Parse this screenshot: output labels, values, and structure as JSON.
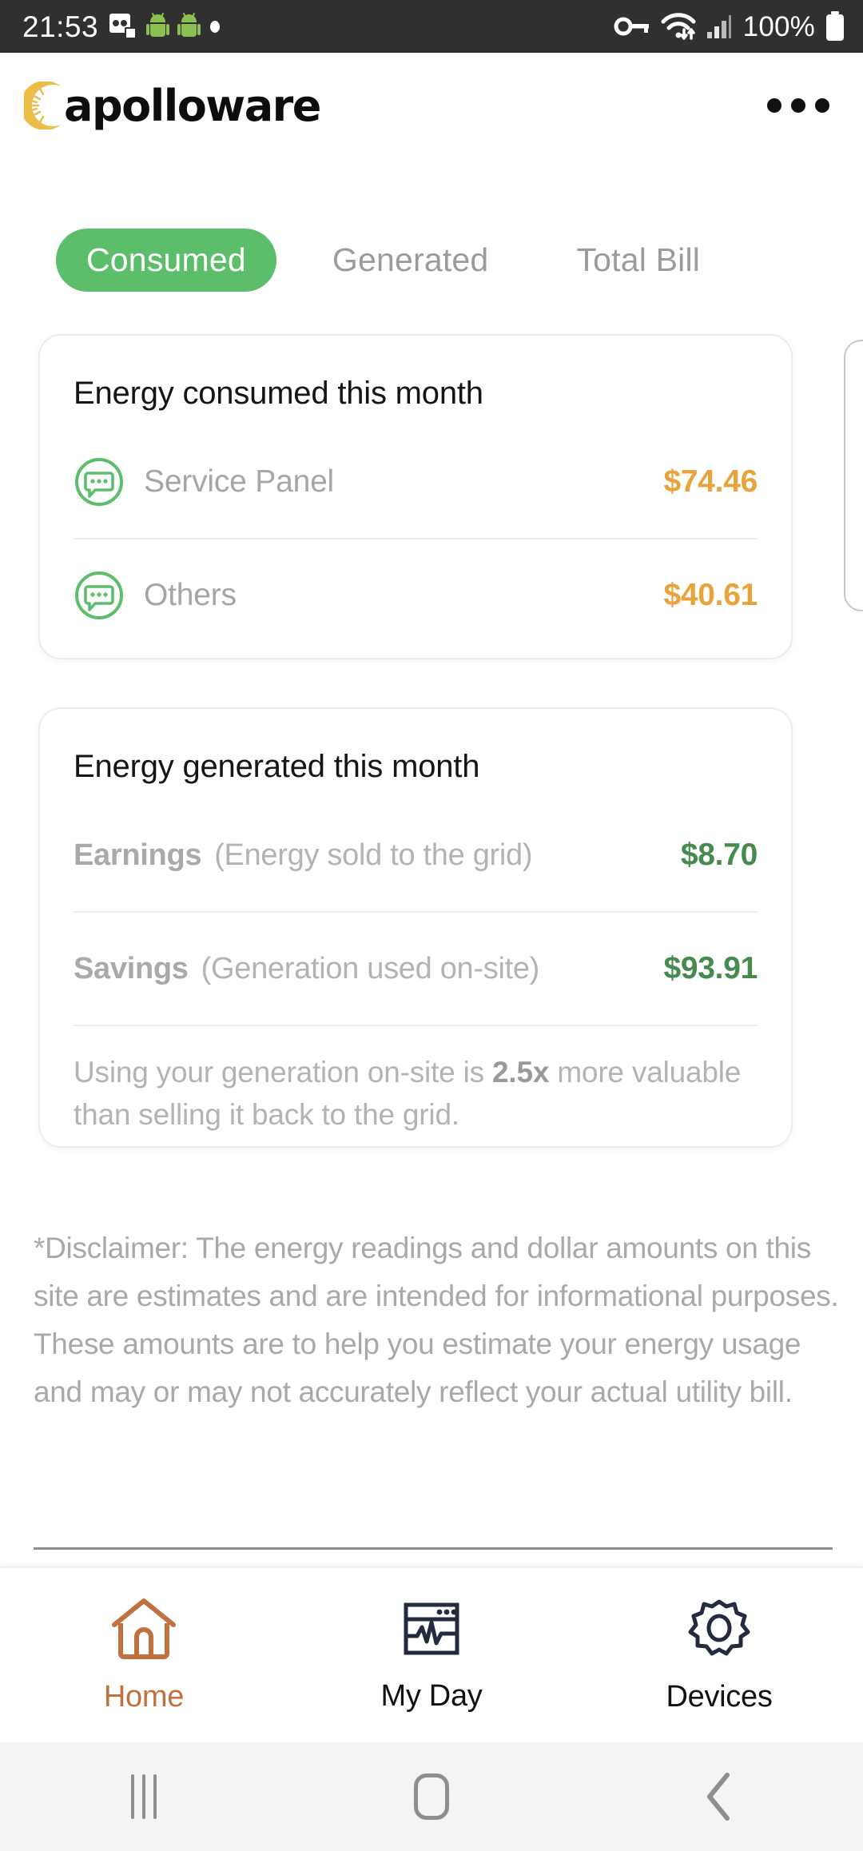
{
  "status_bar": {
    "time": "21:53",
    "battery_percent": "100%",
    "icons": [
      "dual-sim-icon",
      "android-icon",
      "android-icon",
      "dot-icon",
      "vpn-key-icon",
      "wifi-icon",
      "signal-bars-icon",
      "battery-icon"
    ]
  },
  "header": {
    "logo_text": "apolloware",
    "logo_mark": "sun-burst-icon",
    "overflow_menu": "more-options-icon"
  },
  "tabs": [
    {
      "label": "Consumed",
      "active": true
    },
    {
      "label": "Generated",
      "active": false
    },
    {
      "label": "Total Bill",
      "active": false
    }
  ],
  "consumed_card": {
    "title": "Energy consumed this month",
    "rows": [
      {
        "icon": "speech-bubble-icon",
        "label": "Service Panel",
        "amount": "$74.46"
      },
      {
        "icon": "speech-bubble-icon",
        "label": "Others",
        "amount": "$40.61"
      }
    ]
  },
  "generated_card": {
    "title": "Energy generated this month",
    "rows": [
      {
        "label": "Earnings",
        "description": "(Energy sold to the grid)",
        "amount": "$8.70"
      },
      {
        "label": "Savings",
        "description": "(Generation used on-site)",
        "amount": "$93.91"
      }
    ],
    "note_prefix": "Using your generation on-site is ",
    "note_multiplier": "2.5x",
    "note_suffix": " more valuable than selling it back to the grid."
  },
  "disclaimer": "*Disclaimer: The energy readings and dollar amounts on this site are estimates and are intended for informational purposes. These amounts are to help you estimate your energy usage and may or may not accurately reflect your actual utility bill.",
  "bottom_nav": [
    {
      "label": "Home",
      "icon": "house-icon",
      "active": true
    },
    {
      "label": "My Day",
      "icon": "chart-window-icon",
      "active": false
    },
    {
      "label": "Devices",
      "icon": "gear-icon",
      "active": false
    }
  ],
  "system_nav": [
    "recents-button",
    "home-button",
    "back-button"
  ],
  "colors": {
    "accent_green": "#5CBE6B",
    "amount_orange": "#E8A33B",
    "amount_green": "#478A4E",
    "home_orange": "#C1703F",
    "logo_yellow": "#EBBE4A",
    "statusbar_bg": "#303030"
  }
}
